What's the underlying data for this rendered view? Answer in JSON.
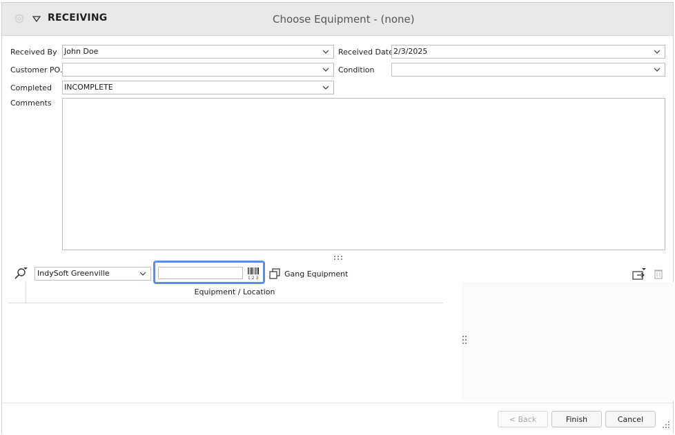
{
  "title": {
    "main": "RECEIVING",
    "center": "Choose Equipment - (none)"
  },
  "form": {
    "received_by_label": "Received By",
    "received_by_value": "John Doe",
    "received_date_label": "Received Date",
    "received_date_value": "2/3/2025",
    "customer_po_label": "Customer PO.",
    "customer_po_value": "",
    "condition_label": "Condition",
    "condition_value": "",
    "completed_label": "Completed",
    "completed_value": "INCOMPLETE",
    "comments_label": "Comments",
    "comments_value": ""
  },
  "toolbar": {
    "site_value": "IndySoft Greenville",
    "scan_value": "",
    "gang_label": "Gang Equipment"
  },
  "grid": {
    "columns": [
      "Equipment / Location"
    ]
  },
  "footer": {
    "back_label": "< Back",
    "finish_label": "Finish",
    "cancel_label": "Cancel"
  },
  "colors": {
    "focus": "#5b8ee0",
    "titlebar": "#e9e9e9"
  },
  "icons": [
    "gear-icon",
    "collapse-triangle-icon",
    "search-icon",
    "barcode-icon",
    "gang-copy-icon",
    "transfer-icon",
    "trash-icon",
    "chevron-down-icon",
    "grip-icon"
  ]
}
